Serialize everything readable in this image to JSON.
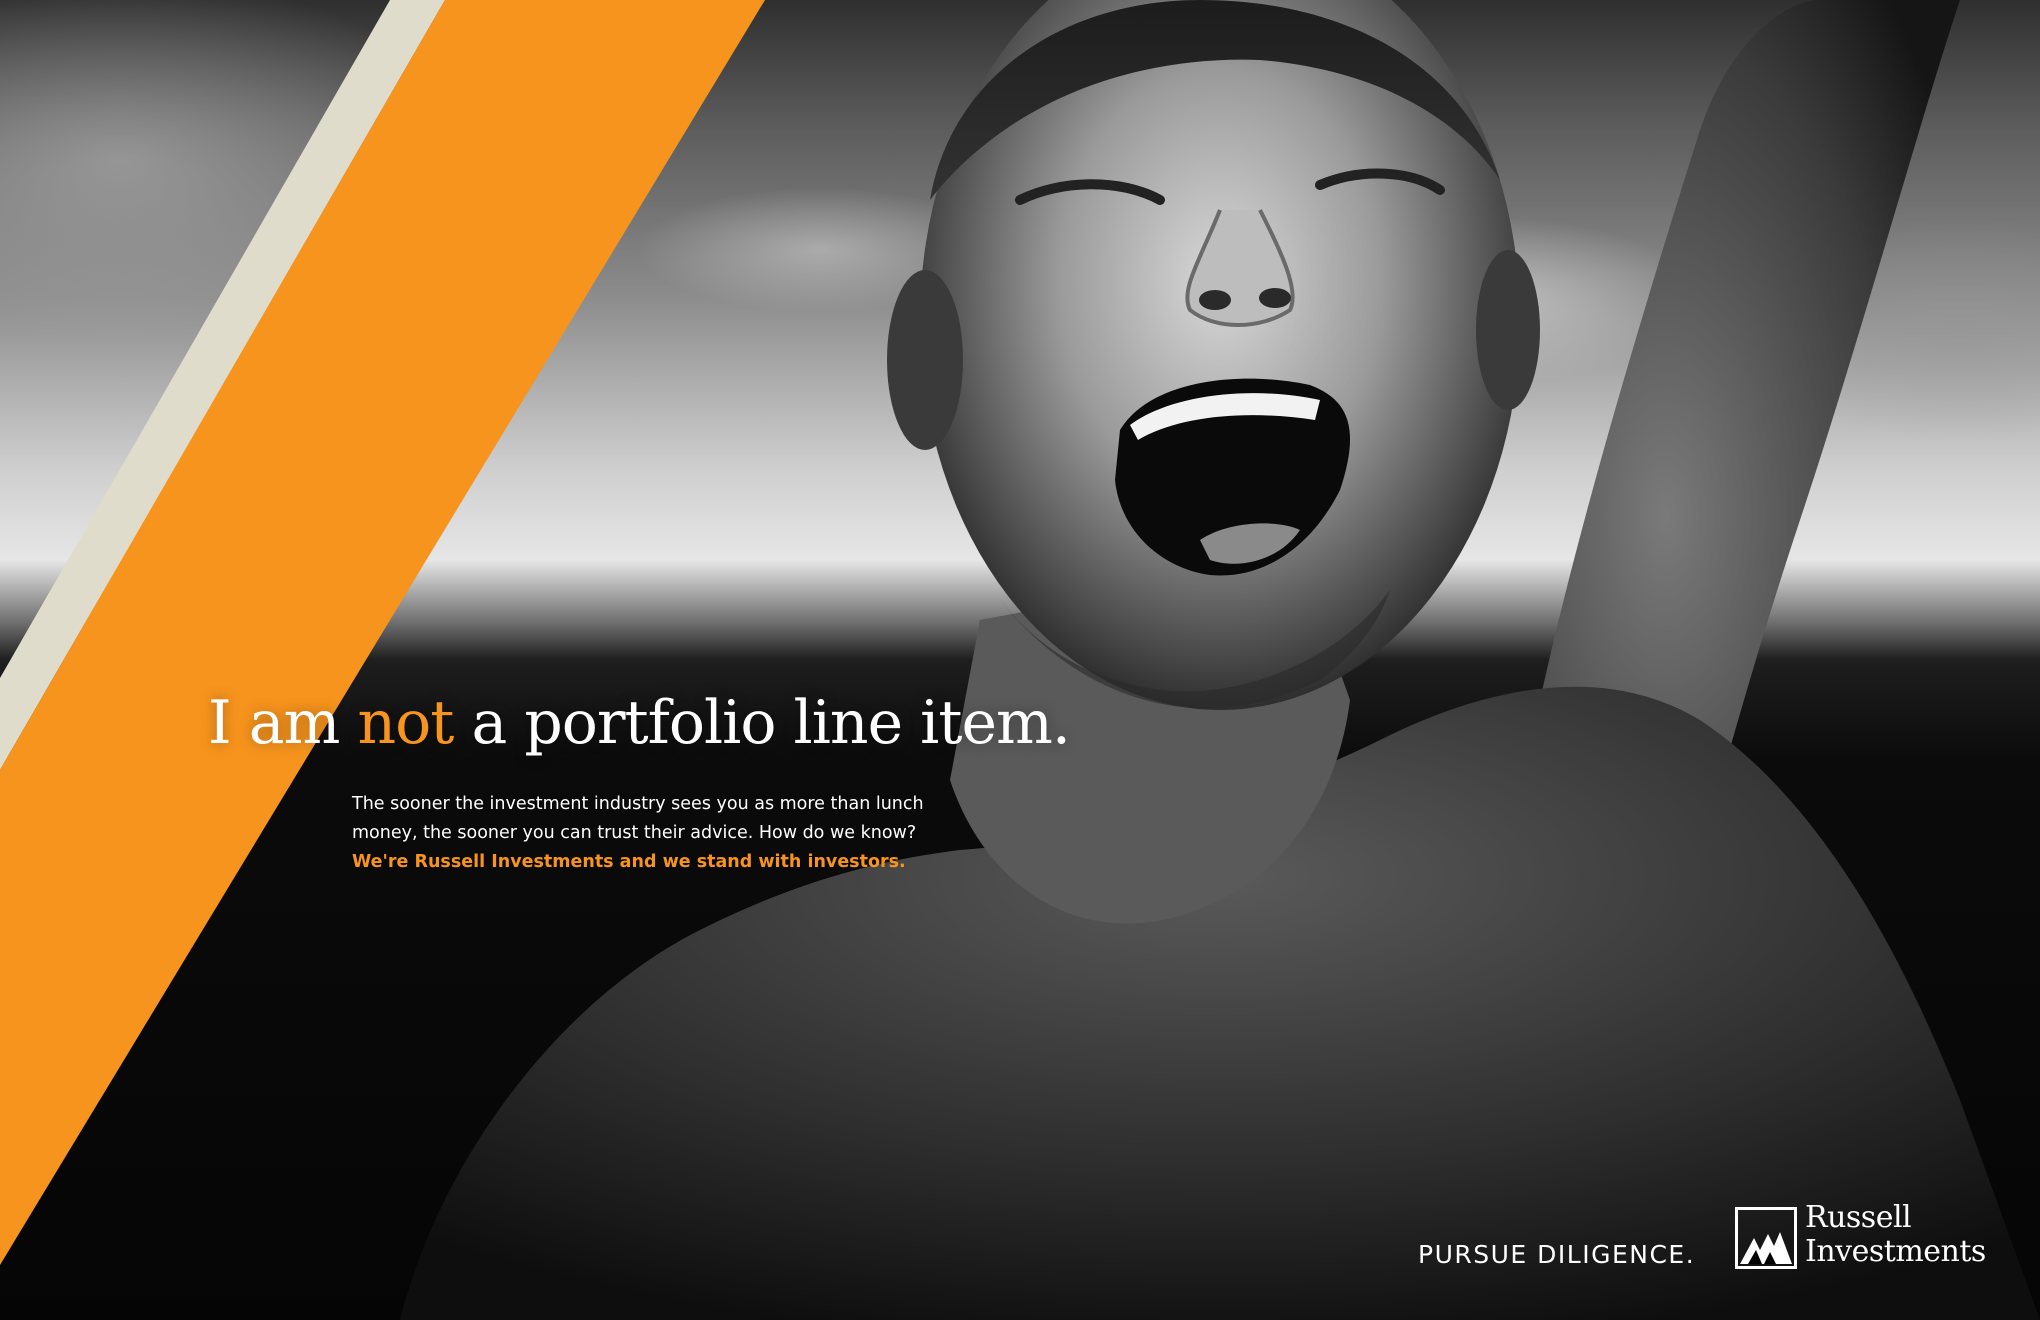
{
  "ad": {
    "headline": {
      "part1": "I am ",
      "accent": "not",
      "part2": " a portfolio line item."
    },
    "body": [
      "The sooner the investment industry sees you as more than lunch",
      "money, the sooner you can trust their advice. How do we know?"
    ],
    "body_emphasis": "We're Russell Investments and we stand with investors.",
    "tagline": "PURSUE DILIGENCE.",
    "logo": {
      "icon": "russell-mountain-logo-icon",
      "line1": "Russell",
      "line2": "Investments"
    }
  },
  "photo": {
    "subject": "laughing-man-black-and-white-photo"
  },
  "colors": {
    "accent_orange": "#f7941d",
    "stripe_cream": "#e0dccb",
    "text_white": "#ffffff"
  }
}
